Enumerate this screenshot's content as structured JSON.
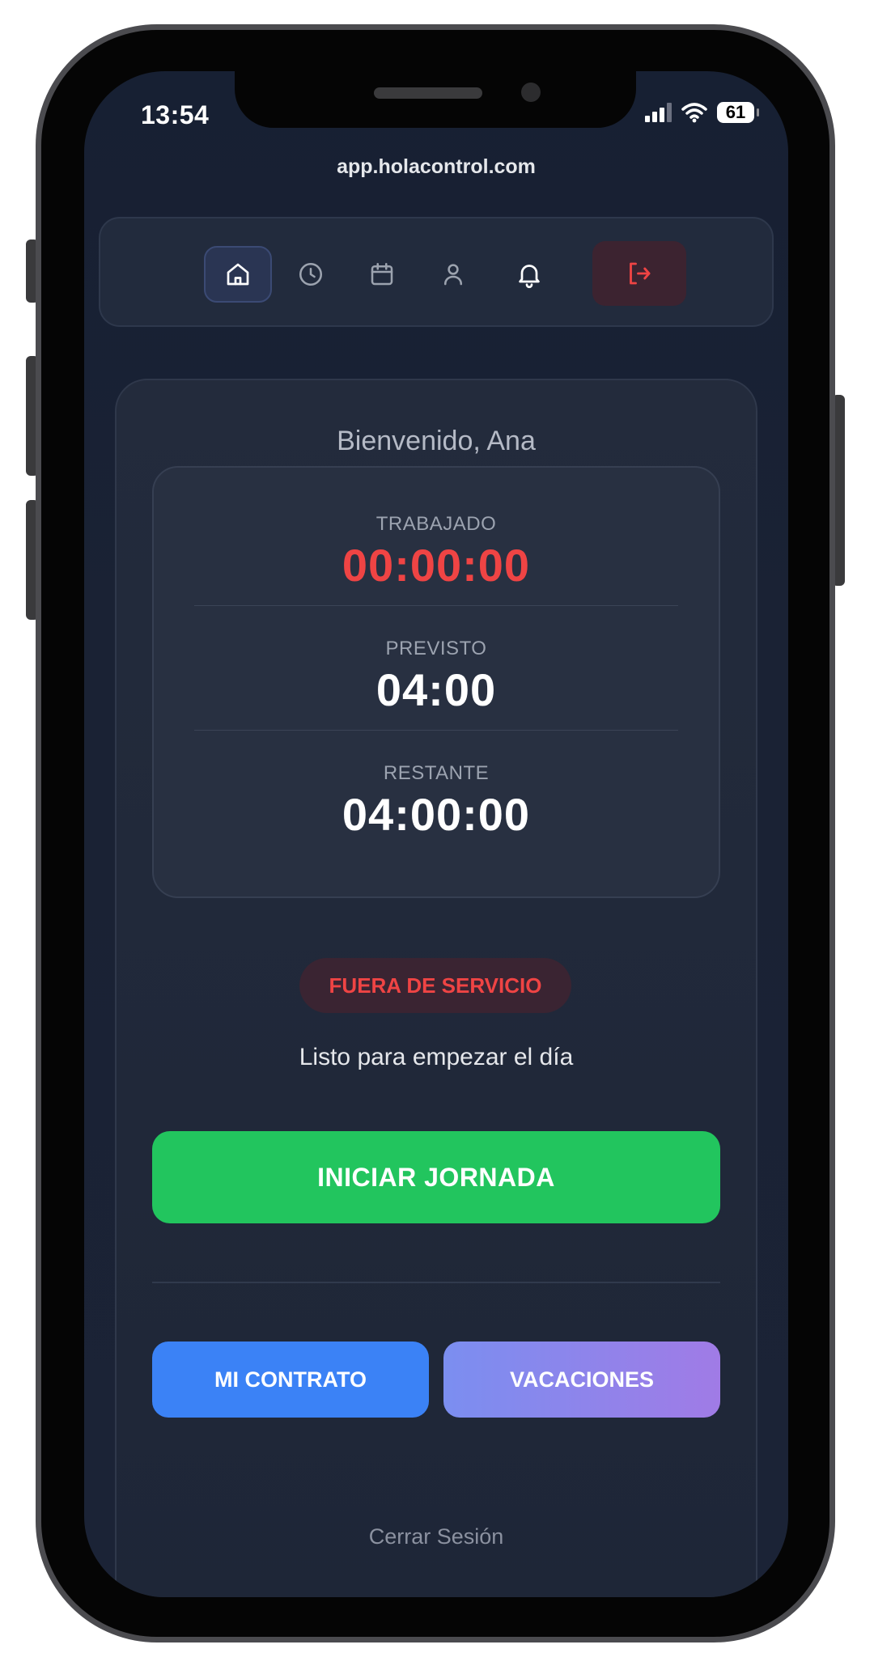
{
  "status_bar": {
    "time": "13:54",
    "battery": "61"
  },
  "browser": {
    "url": "app.holacontrol.com"
  },
  "nav": {
    "items": [
      {
        "icon": "home-icon",
        "active": true
      },
      {
        "icon": "clock-icon"
      },
      {
        "icon": "calendar-icon"
      },
      {
        "icon": "user-icon"
      },
      {
        "icon": "bell-icon"
      },
      {
        "icon": "logout-icon"
      }
    ]
  },
  "main": {
    "welcome": "Bienvenido, Ana",
    "timers": {
      "worked_label": "TRABAJADO",
      "worked_value": "00:00:00",
      "planned_label": "PREVISTO",
      "planned_value": "04:00",
      "remaining_label": "RESTANTE",
      "remaining_value": "04:00:00"
    },
    "status_badge": "FUERA DE SERVICIO",
    "status_message": "Listo para empezar el día",
    "start_button": "INICIAR JORNADA",
    "contract_button": "MI CONTRATO",
    "vacations_button": "VACACIONES",
    "signout_link": "Cerrar Sesión"
  },
  "colors": {
    "background": "#1b2336",
    "accent_green": "#22c55e",
    "accent_red": "#ef4444",
    "accent_blue": "#3b82f6",
    "accent_purple": "#a07be6"
  }
}
